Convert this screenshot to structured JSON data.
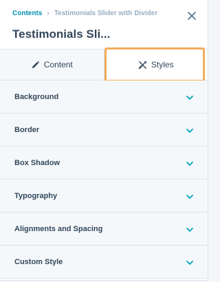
{
  "breadcrumb": {
    "parent": "Contents",
    "separator": "›",
    "current": "Testimonials Slider with Divider"
  },
  "title": "Testimonials Sli...",
  "icons": {
    "close": "close-icon",
    "content_tab": "pencil-icon",
    "styles_tab": "paint-tools-icon",
    "section_toggle": "chevron-down-icon"
  },
  "tabs": {
    "content": "Content",
    "styles": "Styles",
    "active": "Styles"
  },
  "sections": [
    {
      "label": "Background"
    },
    {
      "label": "Border"
    },
    {
      "label": "Box Shadow"
    },
    {
      "label": "Typography"
    },
    {
      "label": "Alignments and Spacing"
    },
    {
      "label": "Custom Style"
    }
  ],
  "colors": {
    "link": "#0091ae",
    "accent_chevron": "#00a4bd",
    "highlight": "#f0ac5b",
    "text": "#33475b"
  }
}
